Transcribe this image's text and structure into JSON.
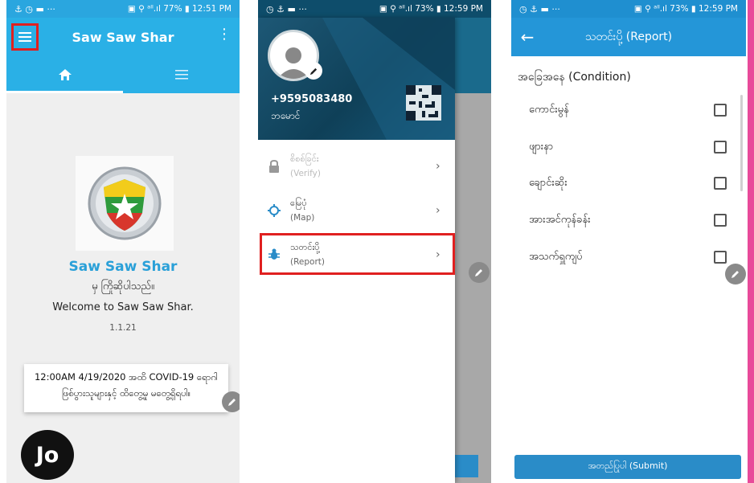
{
  "colors": {
    "accent": "#2ab0e6",
    "header_dark": "#0f4058",
    "highlight": "#e02020",
    "brand_pink": "#e84a9a"
  },
  "screen1": {
    "status_left": "⚓ ◷ ▬ ···",
    "status_right": "▣ ⚲ ᵃˡˡ.ıl 77% ▮ 12:51 PM",
    "title": "Saw Saw Shar",
    "tabs": [
      {
        "icon": "home-icon"
      },
      {
        "icon": "list-icon"
      }
    ],
    "app_name": "Saw Saw Shar",
    "greeting_mm": "မှ ကြိုဆိုပါသည်။",
    "welcome": "Welcome to Saw Saw Shar.",
    "version": "1.1.21",
    "notice_line1": "12:00AM 4/19/2020 အထိ COVID-19 ရောဂါ",
    "notice_line2": "ဖြစ်ပွားသူများနှင့် ထိတွေ့မှု မတွေ့ရှိရပါ။",
    "badge": "JO"
  },
  "screen2": {
    "status_left": "◷ ⚓ ▬ ···",
    "status_right": "▣ ⚲ ᵃˡˡ.ıl 73% ▮ 12:59 PM",
    "phone": "+9595083480",
    "name": "ဘမောင်",
    "menu": [
      {
        "mm": "စိစစ်ခြင်း",
        "en": "(Verify)"
      },
      {
        "mm": "မြေပုံ",
        "en": "(Map)"
      },
      {
        "mm": "သတင်းပို့",
        "en": "(Report)"
      }
    ]
  },
  "screen3": {
    "status_left": "◷ ⚓ ▬ ···",
    "status_right": "▣ ⚲ ᵃˡˡ.ıl 73% ▮ 12:59 PM",
    "title": "သတင်းပို့ (Report)",
    "condition_heading": "အခြေအနေ (Condition)",
    "conditions": [
      "ကောင်းမွန်",
      "ဖျားနာ",
      "ချောင်းဆိုး",
      "အားအင်ကုန်ခန်း",
      "အသက်ရှူကျပ်"
    ],
    "submit": "အတည်ပြုပါ (Submit)"
  }
}
